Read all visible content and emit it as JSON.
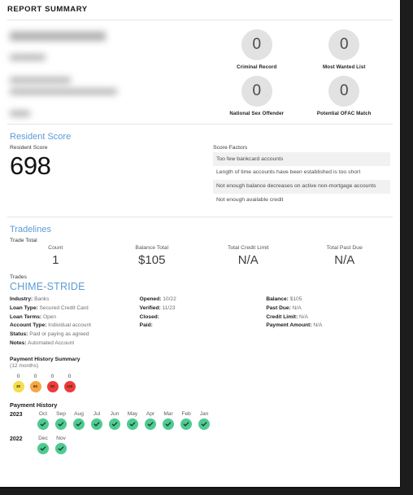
{
  "report": {
    "title": "REPORT SUMMARY"
  },
  "applicant": {
    "redacted": true,
    "redacted_lines": [
      "name",
      "date-of-birth",
      "address-line-1",
      "address-line-2",
      "ssn"
    ]
  },
  "background_checks": [
    {
      "label": "Criminal Record",
      "value": "0"
    },
    {
      "label": "Most Wanted List",
      "value": "0"
    },
    {
      "label": "National Sex Offender",
      "value": "0"
    },
    {
      "label": "Potential OFAC Match",
      "value": "0"
    }
  ],
  "resident_score": {
    "heading": "Resident Score",
    "label": "Resident Score",
    "value": "698",
    "factors_title": "Score Factors",
    "factors": [
      "Too few bankcard accounts",
      "Length of time accounts have been established is too short",
      "Not enough balance decreases on active non-mortgage accounts",
      "Not enough available credit"
    ]
  },
  "tradelines": {
    "heading": "Tradelines",
    "trade_total_label": "Trade Total",
    "totals": [
      {
        "label": "Count",
        "value": "1"
      },
      {
        "label": "Balance Total",
        "value": "$105"
      },
      {
        "label": "Total Credit Limit",
        "value": "N/A"
      },
      {
        "label": "Total Past Due",
        "value": "N/A"
      }
    ],
    "trades_label": "Trades",
    "trade": {
      "name": "CHIME-STRIDE",
      "col1": [
        {
          "label": "Industry:",
          "value": "Banks"
        },
        {
          "label": "Loan Type:",
          "value": "Secured Credit Card"
        },
        {
          "label": "Loan Terms:",
          "value": "Open"
        },
        {
          "label": "Account Type:",
          "value": "Individual account"
        },
        {
          "label": "Status:",
          "value": "Paid or paying as agreed"
        },
        {
          "label": "Notes:",
          "value": "Automated Account"
        }
      ],
      "col2": [
        {
          "label": "Opened:",
          "value": "10/22"
        },
        {
          "label": "Verified:",
          "value": "11/23"
        },
        {
          "label": "Closed:",
          "value": ""
        },
        {
          "label": "Paid:",
          "value": ""
        }
      ],
      "col3": [
        {
          "label": "Balance:",
          "value": "$105"
        },
        {
          "label": "Past Due:",
          "value": "N/A"
        },
        {
          "label": "Credit Limit:",
          "value": "N/A"
        },
        {
          "label": "Payment Amount:",
          "value": "N/A"
        }
      ]
    },
    "payment_history_summary": {
      "title": "Payment History Summary",
      "subtitle": "(12 months)",
      "buckets": [
        {
          "bucket": "30",
          "count": "0",
          "color": "#f5dd4b"
        },
        {
          "bucket": "60",
          "count": "0",
          "color": "#f6a744"
        },
        {
          "bucket": "90",
          "count": "0",
          "color": "#ee3b3b"
        },
        {
          "bucket": "120",
          "count": "0",
          "color": "#ee3b3b"
        }
      ]
    },
    "payment_history": {
      "title": "Payment History",
      "mark_color": "#4ecb91",
      "rows": [
        {
          "year": "2023",
          "months": [
            "Oct",
            "Sep",
            "Aug",
            "Jul",
            "Jun",
            "May",
            "Apr",
            "Mar",
            "Feb",
            "Jan"
          ],
          "status": [
            "ok",
            "ok",
            "ok",
            "ok",
            "ok",
            "ok",
            "ok",
            "ok",
            "ok",
            "ok"
          ]
        },
        {
          "year": "2022",
          "months": [
            "Dec",
            "Nov"
          ],
          "status": [
            "ok",
            "ok"
          ]
        }
      ]
    }
  }
}
